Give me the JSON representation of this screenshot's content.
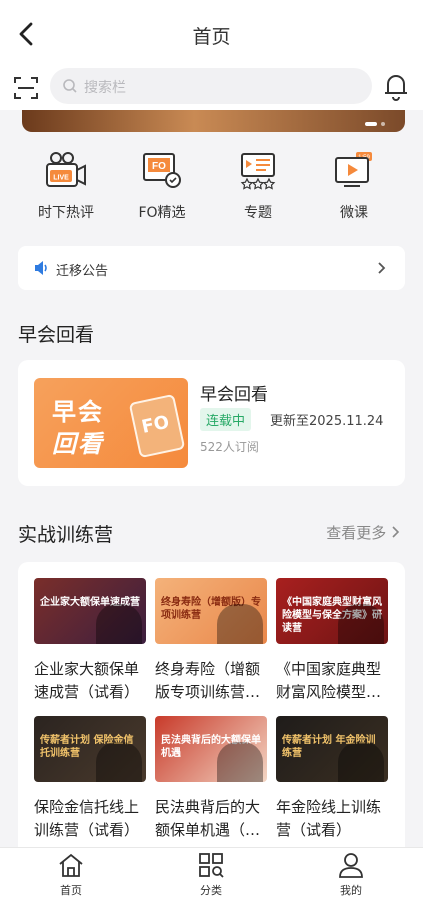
{
  "header": {
    "title": "首页"
  },
  "search": {
    "placeholder": "搜索栏"
  },
  "quick_links": [
    {
      "label": "时下热评",
      "icon": "live-video-icon",
      "badge": "LIVE"
    },
    {
      "label": "FO精选",
      "icon": "fo-badge-icon",
      "badge": "FO"
    },
    {
      "label": "专题",
      "icon": "topic-list-icon"
    },
    {
      "label": "微课",
      "icon": "micro-class-icon",
      "badge": "1:59"
    }
  ],
  "notice": {
    "text": "迁移公告"
  },
  "morning": {
    "section_title": "早会回看",
    "card": {
      "thumb_line1": "早会",
      "thumb_line2": "回看",
      "thumb_fo": "FO",
      "title": "早会回看",
      "tag": "连载中",
      "updated": "更新至2025.11.24",
      "subscribers": "522人订阅"
    }
  },
  "training": {
    "section_title": "实战训练营",
    "more": "查看更多",
    "items": [
      {
        "title": "企业家大额保单速成营（试看）",
        "cover_text": "企业家大额保单速成营",
        "color": "#7a2e2a"
      },
      {
        "title": "终身寿险（增额版专项训练营…",
        "cover_text": "终身寿险（增额版）专项训练营",
        "color": "#e9874a"
      },
      {
        "title": "《中国家庭典型财富风险模型…",
        "cover_text": "《中国家庭典型财富风险模型与保全方案》研读营",
        "color": "#a8201f"
      },
      {
        "title": "保险金信托线上训练营（试看）",
        "cover_text": "传薪者计划 保险金信托训练营",
        "color": "#2b2420"
      },
      {
        "title": "民法典背后的大额保单机遇（…",
        "cover_text": "民法典背后的大额保单机遇",
        "color": "#c83a2a"
      },
      {
        "title": "年金险线上训练营（试看）",
        "cover_text": "传薪者计划 年金险训练营",
        "color": "#1f1c1a"
      }
    ]
  },
  "tabbar": [
    {
      "label": "首页",
      "icon": "home-icon"
    },
    {
      "label": "分类",
      "icon": "category-icon"
    },
    {
      "label": "我的",
      "icon": "profile-icon"
    }
  ],
  "colors": {
    "accent": "#f58a3c",
    "tag_green": "#27a966"
  }
}
